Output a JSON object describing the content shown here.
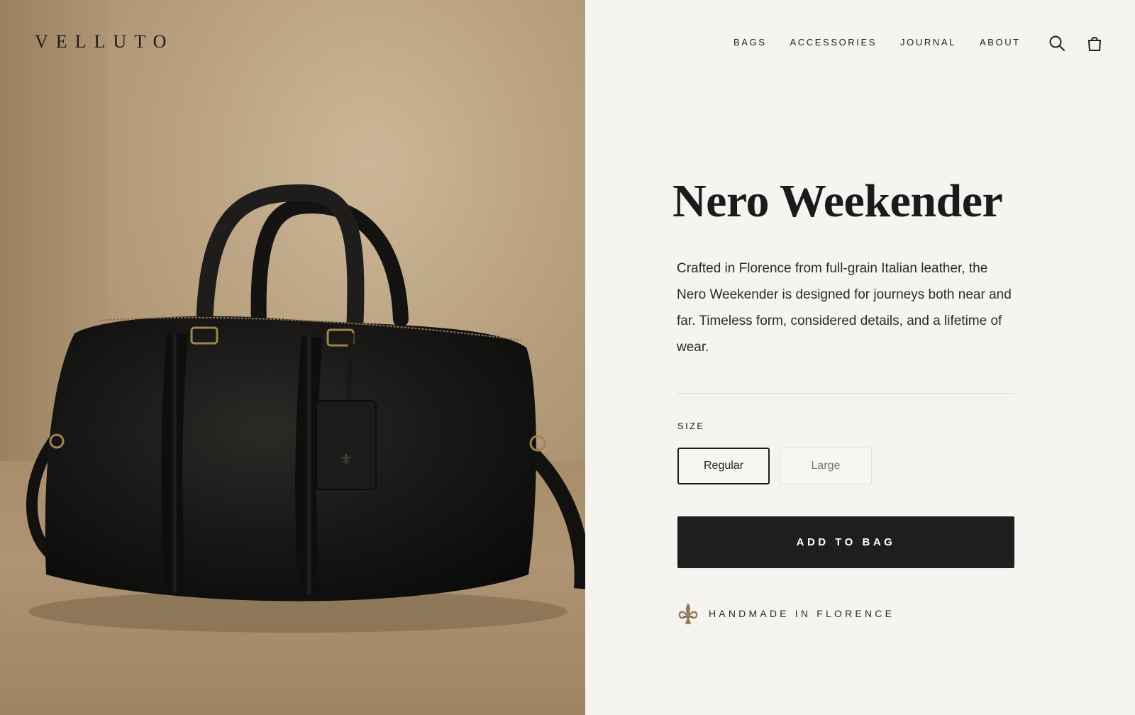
{
  "brand": {
    "logo": "VELLUTO"
  },
  "nav": {
    "items": [
      {
        "label": "BAGS"
      },
      {
        "label": "ACCESSORIES"
      },
      {
        "label": "JOURNAL"
      },
      {
        "label": "ABOUT"
      }
    ],
    "icons": [
      "search-icon",
      "shopping-bag-icon"
    ]
  },
  "hero": {
    "image": "black leather weekender bag on beige backdrop"
  },
  "product": {
    "title": "Nero Weekender",
    "description": "Crafted in Florence from full-grain Italian leather, the Nero Weekender is designed for journeys both near and far. Timeless form, considered details, and a lifetime of wear.",
    "size_label": "SIZE",
    "sizes": [
      {
        "label": "Regular",
        "selected": true
      },
      {
        "label": "Large",
        "selected": false
      }
    ],
    "cta": "ADD TO BAG",
    "craft_note": "HANDMADE IN FLORENCE",
    "craft_icon": "fleur-de-lis-icon"
  },
  "colors": {
    "background": "#f6f4f0",
    "text": "#1e1e1e",
    "button": "#1e1e1f",
    "accent_gold": "#9a8156"
  }
}
